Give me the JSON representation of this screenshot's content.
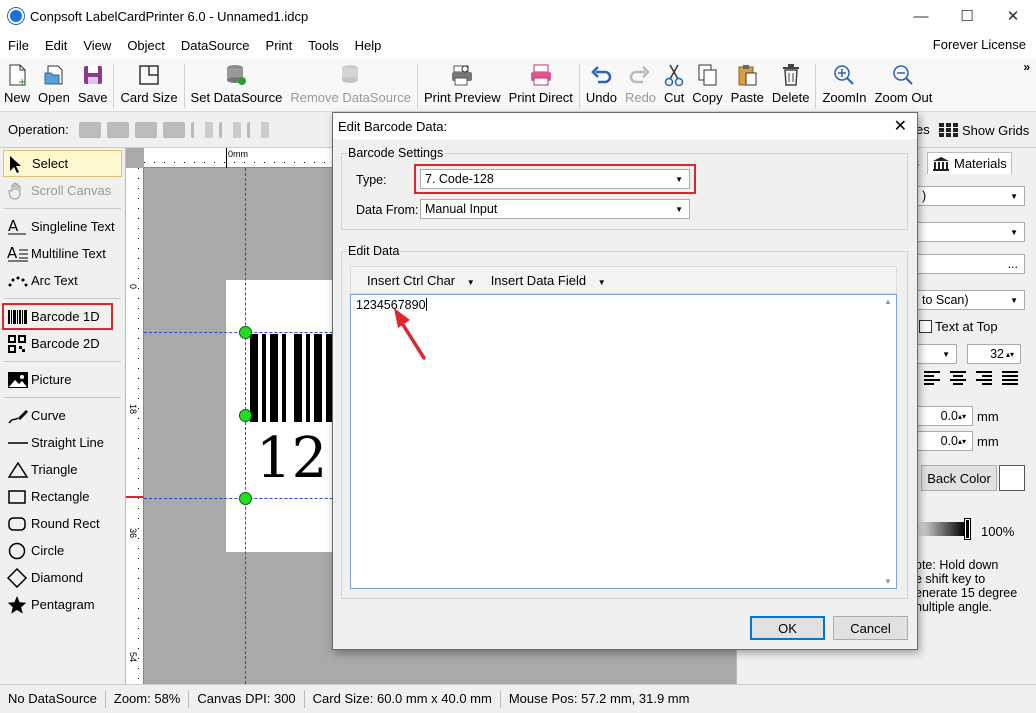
{
  "window": {
    "title": "Conpsoft LabelCardPrinter 6.0 - Unnamed1.idcp",
    "minimize": "—",
    "maximize": "☐",
    "close": "✕"
  },
  "menu": {
    "items": [
      "File",
      "Edit",
      "View",
      "Object",
      "DataSource",
      "Print",
      "Tools",
      "Help"
    ],
    "license": "Forever License"
  },
  "toolbar": {
    "new": "New",
    "open": "Open",
    "save": "Save",
    "card_size": "Card Size",
    "set_datasource": "Set DataSource",
    "remove_datasource": "Remove DataSource",
    "print_preview": "Print Preview",
    "print_direct": "Print Direct",
    "undo": "Undo",
    "redo": "Redo",
    "cut": "Cut",
    "copy": "Copy",
    "paste": "Paste",
    "delete": "Delete",
    "zoom_in": "ZoomIn",
    "zoom_out": "Zoom Out",
    "more": "»"
  },
  "operation": {
    "label": "Operation:",
    "lines": "es",
    "show_grids": "Show Grids"
  },
  "left_tools": {
    "select": "Select",
    "scroll_canvas": "Scroll Canvas",
    "singleline_text": "Singleline Text",
    "multiline_text": "Multiline Text",
    "arc_text": "Arc Text",
    "barcode_1d": "Barcode 1D",
    "barcode_2d": "Barcode 2D",
    "picture": "Picture",
    "curve": "Curve",
    "straight_line": "Straight Line",
    "triangle": "Triangle",
    "rectangle": "Rectangle",
    "round_rect": "Round Rect",
    "circle": "Circle",
    "diamond": "Diamond",
    "pentagram": "Pentagram"
  },
  "ruler": {
    "top_label": "0mm",
    "left_labels": [
      "0",
      "18",
      "36",
      "54"
    ]
  },
  "canvas": {
    "barcode_text": "12"
  },
  "right_panel": {
    "tab_partial": "s",
    "tab_materials": "Materials",
    "combo1_partial": ")",
    "ellipsis": "...",
    "scan_combo": "to Scan)",
    "text_at_top": "Text at Top",
    "font_size": "32",
    "x_value": "0.0",
    "y_value": "0.0",
    "unit": "mm",
    "back_color": "Back Color",
    "opacity": "100%",
    "note_lines": [
      "ote: Hold down",
      "e shift key to",
      "enerate 15 degree",
      "nultiple angle."
    ]
  },
  "status": {
    "datasource": "No DataSource",
    "zoom": "Zoom: 58%",
    "dpi": "Canvas DPI: 300",
    "card_size": "Card Size: 60.0 mm x 40.0 mm",
    "mouse_pos": "Mouse Pos: 57.2 mm, 31.9 mm"
  },
  "dialog": {
    "title": "Edit Barcode Data:",
    "close": "✕",
    "settings_group": "Barcode Settings",
    "type_label": "Type:",
    "type_value": "7.  Code-128",
    "data_from_label": "Data From:",
    "data_from_value": "Manual Input",
    "edit_group": "Edit Data",
    "insert_ctrl_char": "Insert Ctrl Char",
    "insert_data_field": "Insert Data Field",
    "data_value": "1234567890",
    "ok": "OK",
    "cancel": "Cancel"
  },
  "colors": {
    "highlight": "#d9272e",
    "handle": "#22dd22",
    "guide": "#3344cc"
  }
}
